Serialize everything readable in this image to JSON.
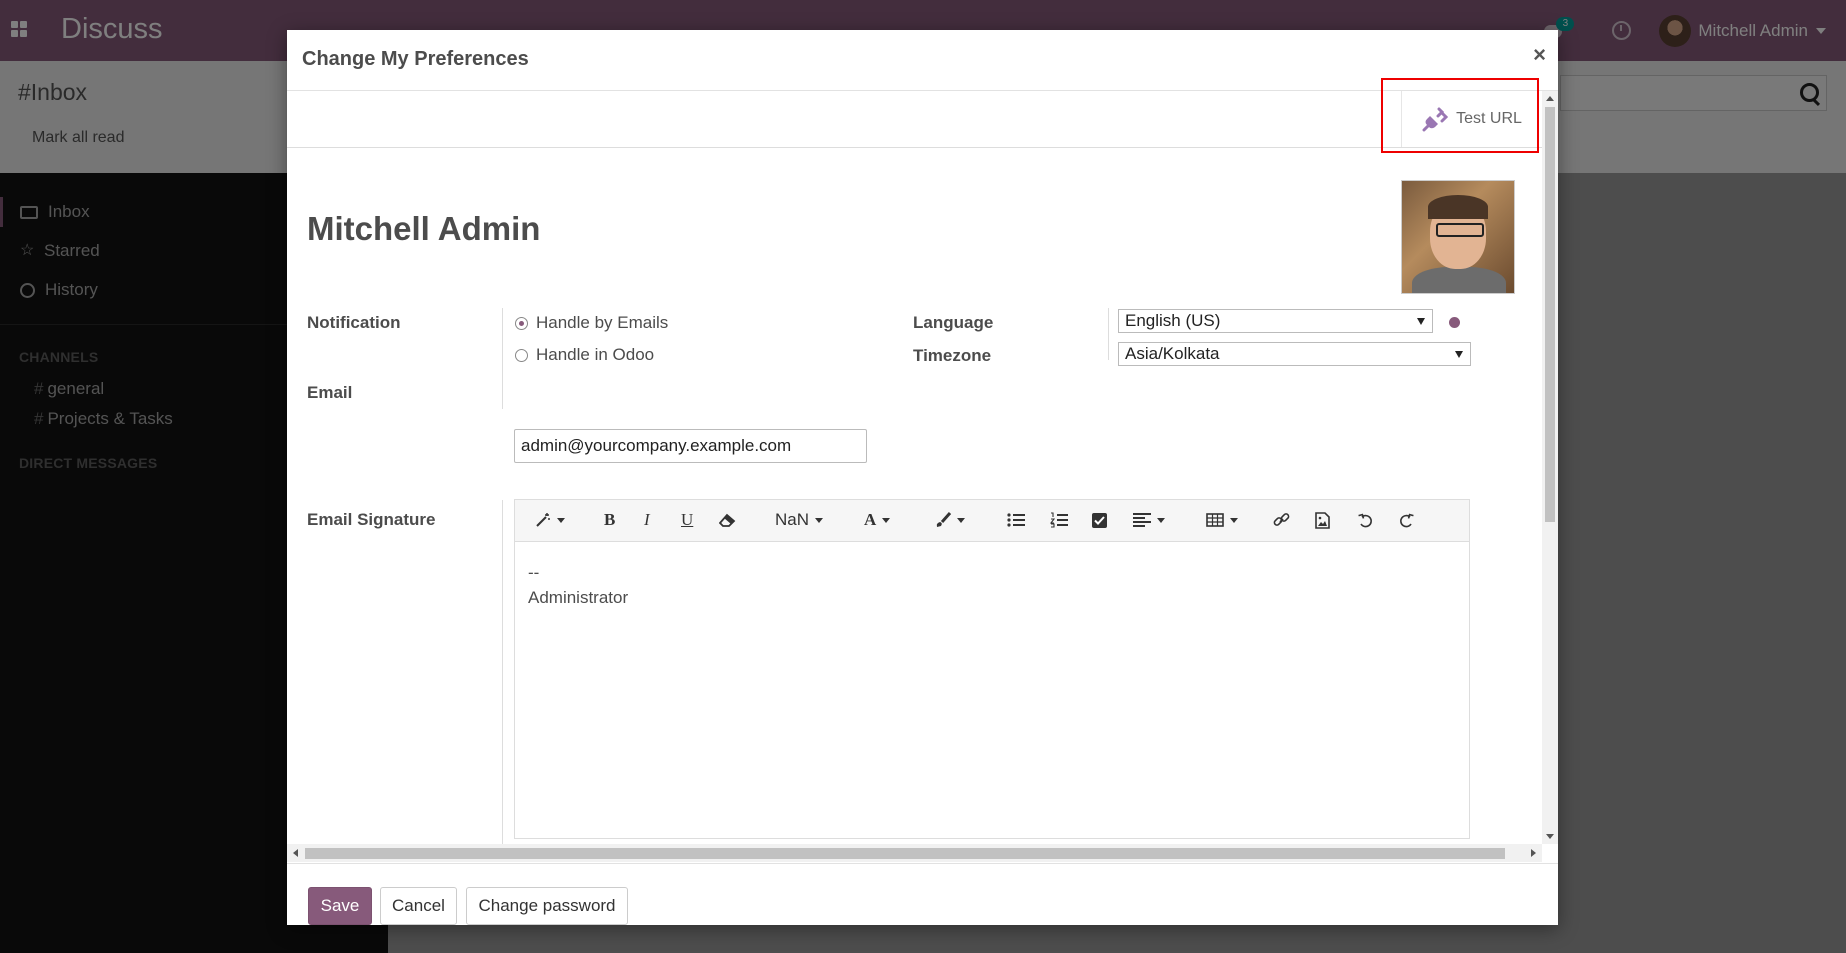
{
  "app": {
    "title": "Discuss",
    "chat_badge": "3",
    "user_name": "Mitchell Admin"
  },
  "control_panel": {
    "title": "#Inbox",
    "mark_all_read": "Mark all read"
  },
  "sidebar": {
    "items": [
      {
        "label": "Inbox",
        "icon": "inbox-icon",
        "active": true
      },
      {
        "label": "Starred",
        "icon": "star-icon"
      },
      {
        "label": "History",
        "icon": "history-icon"
      }
    ],
    "channels_heading": "CHANNELS",
    "channels": [
      "general",
      "Projects & Tasks"
    ],
    "dm_heading": "DIRECT MESSAGES"
  },
  "modal": {
    "title": "Change My Preferences",
    "close": "×",
    "test_url_label": "Test URL",
    "record_name": "Mitchell Admin",
    "notification_label": "Notification",
    "notification_options": [
      "Handle by Emails",
      "Handle in Odoo"
    ],
    "notification_selected": "Handle by Emails",
    "language_label": "Language",
    "language_value": "English (US)",
    "timezone_label": "Timezone",
    "timezone_value": "Asia/Kolkata",
    "email_label": "Email",
    "email_value": "admin@yourcompany.example.com",
    "signature_label": "Email Signature",
    "editor_toolbar": {
      "font_size": "NaN",
      "bold": "B",
      "italic": "I",
      "underline": "U",
      "font_color": "A"
    },
    "signature_lines": [
      "--",
      "Administrator"
    ],
    "footer": {
      "save": "Save",
      "cancel": "Cancel",
      "change_password": "Change password"
    }
  },
  "colors": {
    "brand": "#875a7b",
    "highlight": "#e00000",
    "badge": "#00a09d"
  }
}
